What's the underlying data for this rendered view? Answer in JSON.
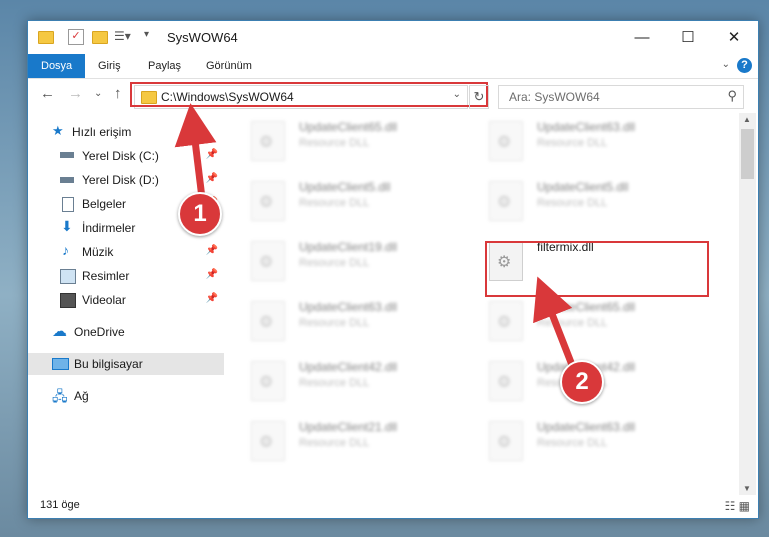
{
  "window": {
    "title": "SysWOW64",
    "controls": {
      "minimize": "—",
      "maximize": "☐",
      "close": "✕"
    }
  },
  "ribbon": {
    "tabs": [
      "Dosya",
      "Giriş",
      "Paylaş",
      "Görünüm"
    ],
    "help": "?"
  },
  "address": {
    "path": "C:\\Windows\\SysWOW64",
    "search_placeholder": "Ara: SysWOW64"
  },
  "sidebar": {
    "items": [
      {
        "label": "Hızlı erişim",
        "icon": "star-icon"
      },
      {
        "label": "Yerel Disk (C:)",
        "icon": "drive-icon",
        "pinned": true
      },
      {
        "label": "Yerel Disk (D:)",
        "icon": "drive-icon",
        "pinned": true
      },
      {
        "label": "Belgeler",
        "icon": "document-icon",
        "pinned": true
      },
      {
        "label": "İndirmeler",
        "icon": "download-icon",
        "pinned": true
      },
      {
        "label": "Müzik",
        "icon": "music-icon",
        "pinned": true
      },
      {
        "label": "Resimler",
        "icon": "pictures-icon",
        "pinned": true
      },
      {
        "label": "Videolar",
        "icon": "video-icon",
        "pinned": true
      },
      {
        "label": "OneDrive",
        "icon": "cloud-icon"
      },
      {
        "label": "Bu bilgisayar",
        "icon": "computer-icon",
        "selected": true
      },
      {
        "label": "Ağ",
        "icon": "network-icon"
      }
    ]
  },
  "files": [
    {
      "name": "UpdateClient65.dll",
      "desc": "Resource DLL",
      "blurred": true
    },
    {
      "name": "UpdateClient63.dll",
      "desc": "Resource DLL",
      "blurred": true
    },
    {
      "name": "UpdateClient5.dll",
      "desc": "Resource DLL",
      "blurred": true
    },
    {
      "name": "UpdateClient5.dll",
      "desc": "Resource DLL",
      "blurred": true
    },
    {
      "name": "UpdateClient19.dll",
      "desc": "Resource DLL",
      "blurred": true
    },
    {
      "name": "filtermix.dll",
      "desc": "",
      "blurred": false
    },
    {
      "name": "UpdateClient63.dll",
      "desc": "Resource DLL",
      "blurred": true
    },
    {
      "name": "UpdateClient65.dll",
      "desc": "Resource DLL",
      "blurred": true
    },
    {
      "name": "UpdateClient42.dll",
      "desc": "Resource DLL",
      "blurred": true
    },
    {
      "name": "UpdateClient42.dll",
      "desc": "Resource DLL",
      "blurred": true
    },
    {
      "name": "UpdateClient21.dll",
      "desc": "Resource DLL",
      "blurred": true
    },
    {
      "name": "UpdateClient63.dll",
      "desc": "Resource DLL",
      "blurred": true
    }
  ],
  "status": {
    "count": "131 öge"
  },
  "annotations": {
    "step1": "1",
    "step2": "2",
    "color": "#d9383a"
  }
}
